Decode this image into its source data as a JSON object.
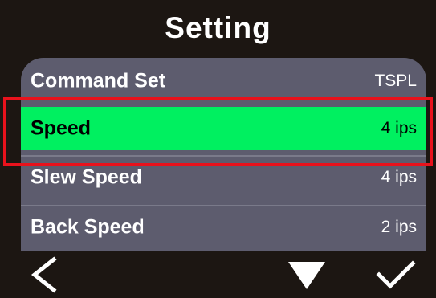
{
  "header": {
    "title": "Setting"
  },
  "menu": {
    "items": [
      {
        "label": "Command Set",
        "value": "TSPL",
        "selected": false
      },
      {
        "label": "Speed",
        "value": "4 ips",
        "selected": true
      },
      {
        "label": "Slew Speed",
        "value": "4 ips",
        "selected": false
      },
      {
        "label": "Back Speed",
        "value": "2 ips",
        "selected": false
      }
    ]
  },
  "colors": {
    "background": "#1c1612",
    "panel": "#5d5c6e",
    "selected_row": "#00f060",
    "highlight_border": "#e8121c"
  },
  "footer": {
    "buttons": [
      {
        "icon": "chevron-left-icon"
      },
      {
        "icon": "triangle-down-icon"
      },
      {
        "icon": "checkmark-icon"
      }
    ]
  }
}
